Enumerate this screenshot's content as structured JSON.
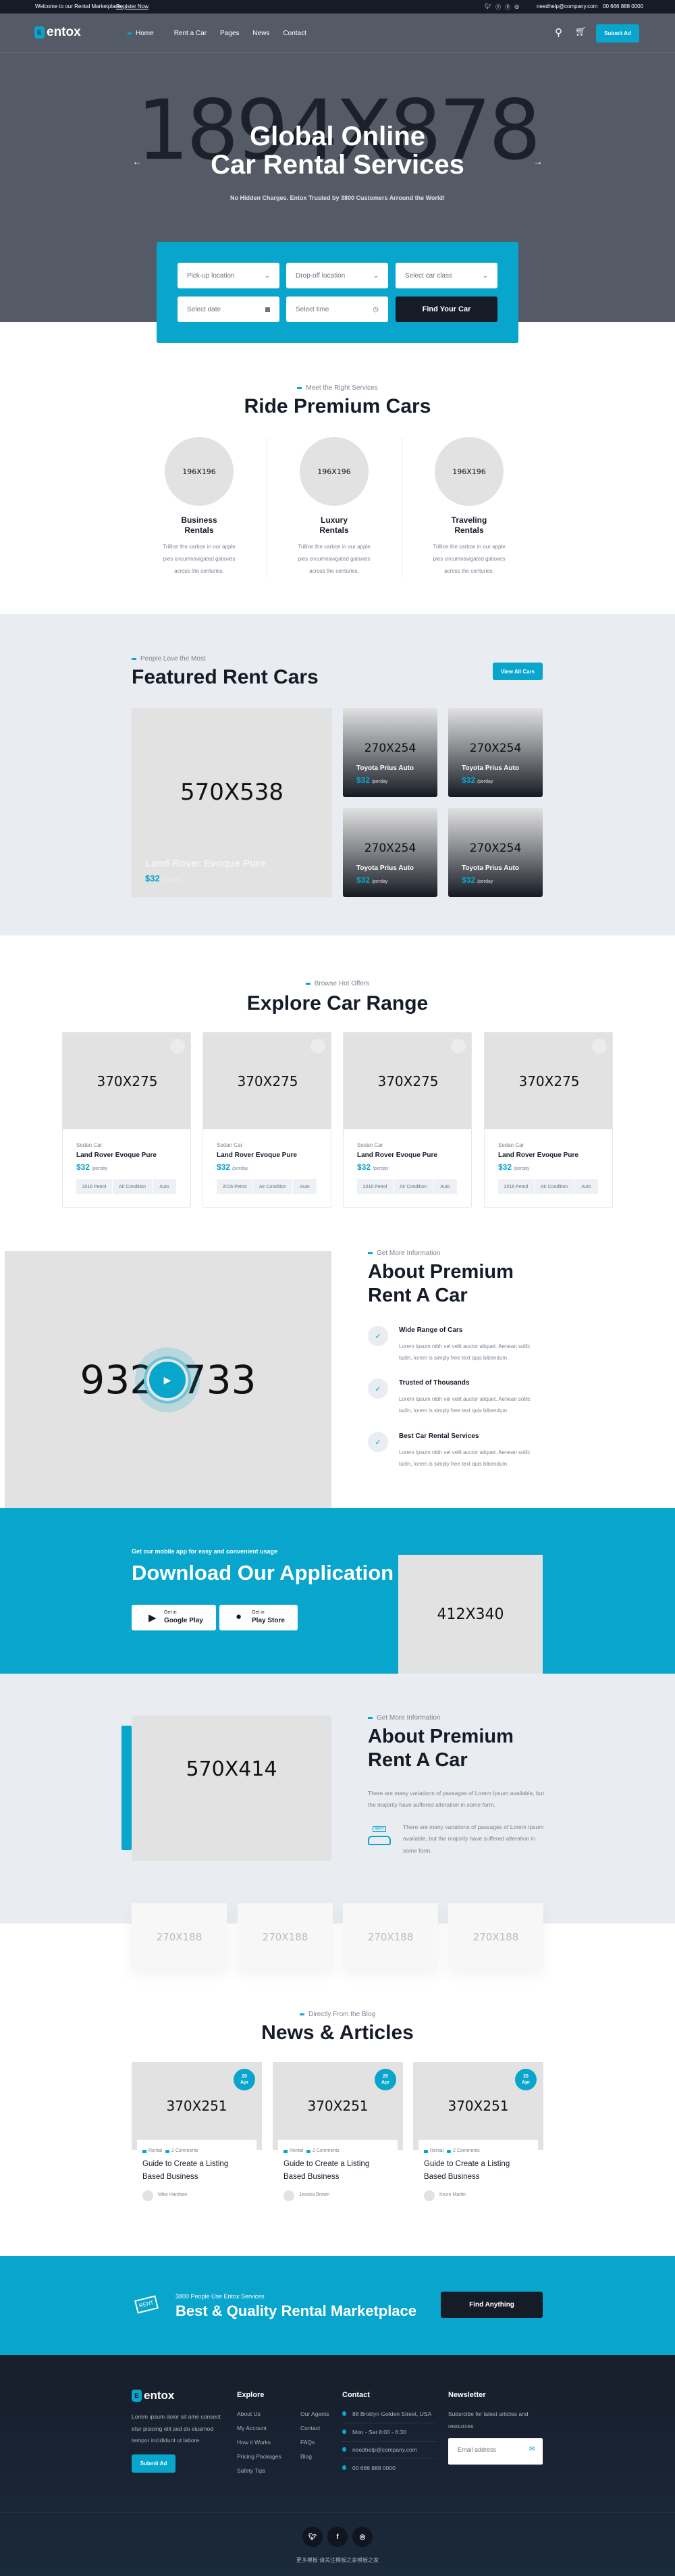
{
  "colors": {
    "accent": "#08a5cc",
    "dark": "#151c28",
    "hero_bg": "#555b66",
    "section_gray": "#e9ecf1"
  },
  "topbar": {
    "welcome": "Welcome to our Rental Marketplace,",
    "register": "Register Now",
    "email": "needhelp@company.com",
    "phone": "00 666 888 0000",
    "social": [
      "twitter-icon",
      "facebook-icon",
      "pinterest-icon",
      "instagram-icon"
    ]
  },
  "header": {
    "logo_letter": "E",
    "logo": "entox",
    "nav": [
      "Home",
      "Rent a Car",
      "Pages",
      "News",
      "Contact"
    ],
    "active_nav": "Home",
    "submit": "Submit Ad"
  },
  "hero": {
    "placeholder": "1894X878",
    "title_1": "Global Online",
    "title_2": "Car Rental Services",
    "subtitle": "No Hidden Charges. Entox Trusted by 3800 Customers Arround the World!"
  },
  "search": {
    "pickup": "Pick-up location",
    "dropoff": "Drop-off location",
    "car_class": "Select car class",
    "date": "Select date",
    "time": "Select time",
    "button": "Find Your Car"
  },
  "services": {
    "eyebrow": "Meet the Right Services",
    "title": "Ride Premium Cars",
    "items": [
      {
        "img": "196X196",
        "title_1": "Business",
        "title_2": "Rentals",
        "desc": [
          "Trillion the carbon in our apple",
          "pies circumnavigated galaxies",
          "across the centuries."
        ]
      },
      {
        "img": "196X196",
        "title_1": "Luxury",
        "title_2": "Rentals",
        "desc": [
          "Trillion the carbon in our apple",
          "pies circumnavigated galaxies",
          "across the centuries."
        ]
      },
      {
        "img": "196X196",
        "title_1": "Traveling",
        "title_2": "Rentals",
        "desc": [
          "Trillion the carbon in our apple",
          "pies circumnavigated galaxies",
          "across the centuries."
        ]
      }
    ]
  },
  "featured": {
    "eyebrow": "People Love the Most",
    "title": "Featured Rent Cars",
    "button": "View All Cars",
    "big": {
      "img": "570X538",
      "name": "Land Rover Evoque Pure",
      "price": "$32",
      "unit": "/perday"
    },
    "small": [
      {
        "img": "270X254",
        "name": "Toyota Prius Auto",
        "price": "$32",
        "unit": "/perday"
      },
      {
        "img": "270X254",
        "name": "Toyota Prius Auto",
        "price": "$32",
        "unit": "/perday"
      },
      {
        "img": "270X254",
        "name": "Toyota Prius Auto",
        "price": "$32",
        "unit": "/perday"
      },
      {
        "img": "270X254",
        "name": "Toyota Prius Auto",
        "price": "$32",
        "unit": "/perday"
      }
    ]
  },
  "explore": {
    "eyebrow": "Browse Hot Offers",
    "title": "Explore Car Range",
    "cards": [
      {
        "img": "370X275",
        "type": "Sedan Car",
        "name": "Land Rover Evoque Pure",
        "price": "$32",
        "unit": "/perday",
        "specs": [
          "2016 Petrol",
          "Air Condition",
          "Auto"
        ]
      },
      {
        "img": "370X275",
        "type": "Sedan Car",
        "name": "Land Rover Evoque Pure",
        "price": "$32",
        "unit": "/perday",
        "specs": [
          "2016 Petrol",
          "Air Condition",
          "Auto"
        ]
      },
      {
        "img": "370X275",
        "type": "Sedan Car",
        "name": "Land Rover Evoque Pure",
        "price": "$32",
        "unit": "/perday",
        "specs": [
          "2016 Petrol",
          "Air Condition",
          "Auto"
        ]
      },
      {
        "img": "370X275",
        "type": "Sedan Car",
        "name": "Land Rover Evoque Pure",
        "price": "$32",
        "unit": "/perday",
        "specs": [
          "2016 Petrol",
          "Air Condition",
          "Auto"
        ]
      }
    ]
  },
  "about": {
    "img": "932X733",
    "eyebrow": "Get More Information",
    "title_1": "About Premium",
    "title_2": "Rent A Car",
    "items": [
      {
        "title": "Wide Range of Cars",
        "desc": [
          "Lorem Ipsum nibh vel velit auctor aliquet. Aenean sollic",
          "tudin, lorem is simply free text quis bibendum."
        ]
      },
      {
        "title": "Trusted of Thousands",
        "desc": [
          "Lorem Ipsum nibh vel velit auctor aliquet. Aenean sollic",
          "tudin, lorem is simply free text quis bibendum."
        ]
      },
      {
        "title": "Best Car Rental Services",
        "desc": [
          "Lorem Ipsum nibh vel velit auctor aliquet. Aenean sollic",
          "tudin, lorem is simply free text quis bibendum."
        ]
      }
    ]
  },
  "app": {
    "eyebrow": "Get our mobile app for easy and convenient usage",
    "title": "Download Our Application",
    "img": "412X340",
    "buttons": [
      {
        "small": "Get in",
        "label": "Google Play"
      },
      {
        "small": "Get in",
        "label": "Play Store"
      }
    ]
  },
  "about2": {
    "img": "570X414",
    "eyebrow": "Get More Information",
    "title_1": "About Premium",
    "title_2": "Rent A Car",
    "para": [
      "There are many variations of passages of Lorem Ipsum available, but",
      "the majority have suffered alteration in some form."
    ],
    "icon_text": [
      "There are many variations of passages of Lorem Ipsum",
      "available, but the majority have suffered alteration in",
      "some form."
    ],
    "icon_label": "RENT",
    "logos": [
      "270X188",
      "270X188",
      "270X188",
      "270X188"
    ]
  },
  "news": {
    "eyebrow": "Directly From the Blog",
    "title": "News & Articles",
    "posts": [
      {
        "img": "370X251",
        "day": "20",
        "month": "Apr",
        "tag": "Rental",
        "comments": "2 Comments",
        "title_1": "Guide to Create a Listing",
        "title_2": "Based Business",
        "author": "Mike Hardson"
      },
      {
        "img": "370X251",
        "day": "20",
        "month": "Apr",
        "tag": "Rental",
        "comments": "2 Comments",
        "title_1": "Guide to Create a Listing",
        "title_2": "Based Business",
        "author": "Jessica Brown"
      },
      {
        "img": "370X251",
        "day": "20",
        "month": "Apr",
        "tag": "Rental",
        "comments": "2 Comments",
        "title_1": "Guide to Create a Listing",
        "title_2": "Based Business",
        "author": "Kevin Martin"
      }
    ]
  },
  "cta": {
    "icon_label": "RENT",
    "eyebrow": "3800 People Use Entox Services",
    "title": "Best & Quality Rental Marketplace",
    "button": "Find Anything"
  },
  "footer": {
    "logo_letter": "E",
    "logo": "entox",
    "desc": [
      "Lorem ipsum dolor sit ame consect",
      "etur pisicing elit sed do eiusmod",
      "tempor incididunt ut labore."
    ],
    "submit": "Submit Ad",
    "explore_title": "Explore",
    "explore_col1": [
      "About Us",
      "My Account",
      "How it Works",
      "Pricing Packages",
      "Safety Tips"
    ],
    "explore_col2": [
      "Our Agents",
      "Contact",
      "FAQs",
      "Blog"
    ],
    "contact_title": "Contact",
    "contact": [
      {
        "icon": "map-pin-icon",
        "text": "88 Broklyn Golden Street, USA"
      },
      {
        "icon": "clock-icon",
        "text": "Mon - Sat 8:00 - 6:30"
      },
      {
        "icon": "envelope-icon",
        "text": "needhelp@company.com"
      },
      {
        "icon": "phone-icon",
        "text": "00 666 888 0000"
      }
    ],
    "newsletter_title": "Newsletter",
    "newsletter_text": [
      "Subsrcibe for latest articles and",
      "resources"
    ],
    "email_placeholder": "Email address",
    "social": [
      "twitter-icon",
      "facebook-icon",
      "instagram-icon"
    ],
    "copyright": "更多模板 请关注模板之家模板之家"
  }
}
